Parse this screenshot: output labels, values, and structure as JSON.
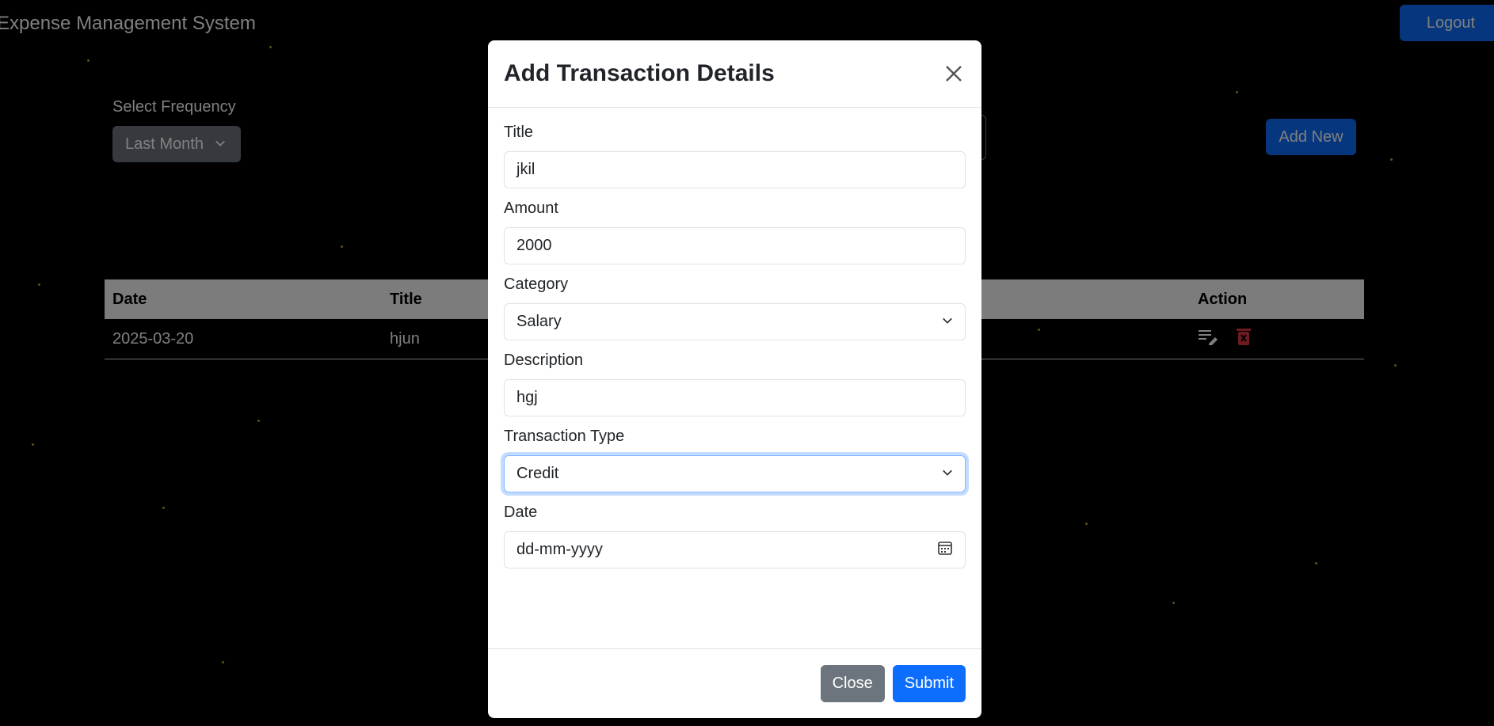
{
  "app": {
    "title": "Expense Management System",
    "logout_label": "Logout"
  },
  "filters": {
    "frequency_label": "Select Frequency",
    "frequency_value": "Last Month",
    "add_new_label": "Add New"
  },
  "table": {
    "headers": {
      "date": "Date",
      "title": "Title",
      "action": "Action"
    },
    "rows": [
      {
        "date": "2025-03-20",
        "title": "hjun"
      }
    ]
  },
  "modal": {
    "title": "Add Transaction Details",
    "fields": {
      "title": {
        "label": "Title",
        "value": "jkil"
      },
      "amount": {
        "label": "Amount",
        "value": "2000"
      },
      "category": {
        "label": "Category",
        "value": "Salary"
      },
      "description": {
        "label": "Description",
        "value": "hgj"
      },
      "transaction_type": {
        "label": "Transaction Type",
        "value": "Credit"
      },
      "date": {
        "label": "Date",
        "placeholder": "dd-mm-yyyy"
      }
    },
    "close_label": "Close",
    "submit_label": "Submit"
  },
  "colors": {
    "primary": "#0d6efd",
    "secondary": "#6c757d",
    "danger": "#dc3545",
    "star": "#c79a3a"
  },
  "icons": [
    "close-icon",
    "chevron-down-icon",
    "calendar-icon",
    "edit-icon",
    "delete-icon"
  ]
}
